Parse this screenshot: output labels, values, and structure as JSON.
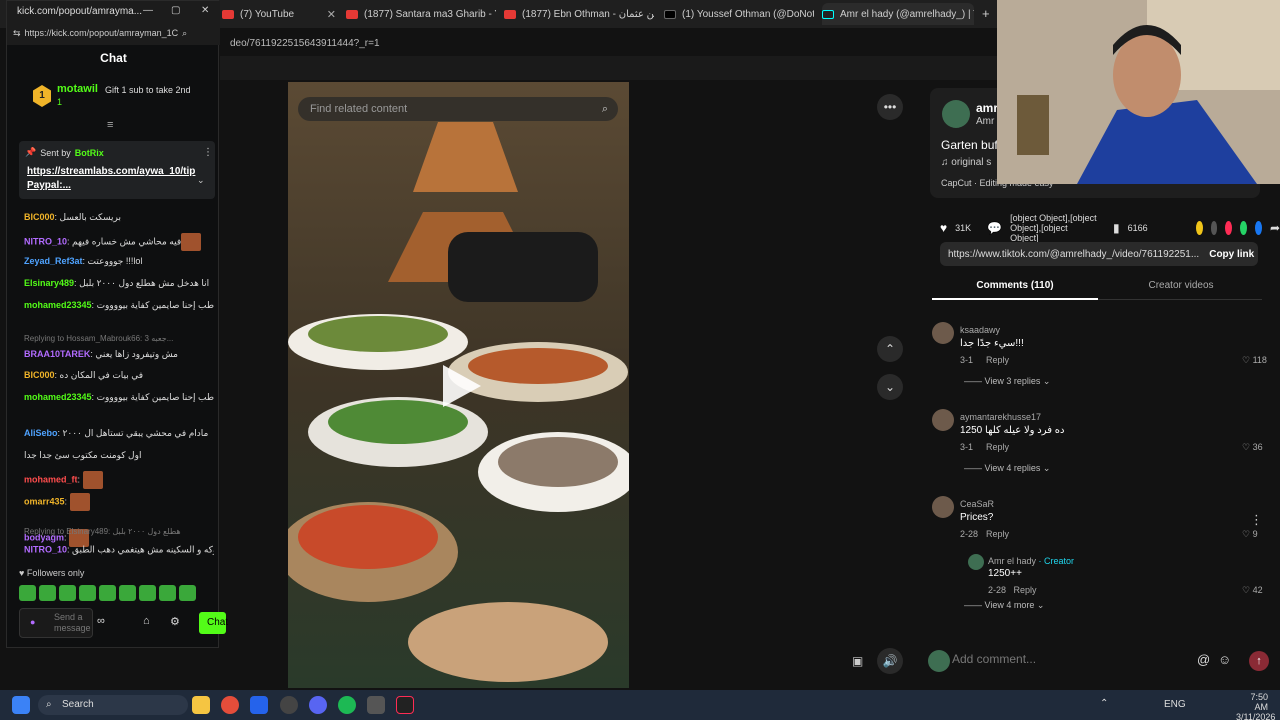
{
  "browser": {
    "tabs": [
      {
        "label": "(7) YouTube"
      },
      {
        "label": "(1877) Santara ma3 Gharib - Yo"
      },
      {
        "label": "(1877) Ebn Othman - ابن عثمان"
      },
      {
        "label": "(1) Youssef Othman (@DoNotG"
      },
      {
        "label": "Amr el hady (@amrelhady_) | T"
      }
    ],
    "url_fragment": "deo/7611922515643911444?_r=1"
  },
  "kick": {
    "window_title": "kick.com/popout/amrayma...",
    "address": "https://kick.com/popout/amrayman_1C",
    "chat_title": "Chat",
    "top_gifter": {
      "rank": "1",
      "name": "motawil",
      "count": "1"
    },
    "gift_prompt": "Gift 1 sub to take 2nd",
    "pinned": {
      "sent_by": "Sent by",
      "bot": "BotRix",
      "link": "https://streamlabs.com/aywa_10/tip",
      "extra": "Paypal:..."
    },
    "messages": [
      {
        "user": "BIC000",
        "text": "بريسكت بالعسل",
        "color": "#f0b429"
      },
      {
        "user": "NITRO_10",
        "text": "فيه محاشي مش خساره فيهم",
        "color": "#b26bff"
      },
      {
        "user": "Zeyad_Ref3at",
        "text": "جوووعتت !!!lol",
        "color": "#4fa3ff"
      },
      {
        "user": "Elsinary489",
        "text": "انا هدخل مش هطلع دول ٢٠٠٠ بلبل",
        "color": "#53fc18"
      },
      {
        "user": "mohamed23345",
        "text": "طب إحنا صايمين كفاية بيووووت",
        "color": "#53fc18"
      },
      {
        "user": "BRAA10TAREK",
        "text": "مش وتيفرود زاها يعني",
        "color": "#b26bff",
        "reply": "Replying to Hossam_Mabrouk66: جعبه 3..."
      },
      {
        "user": "BIC000",
        "text": "في بيات في المكان ده",
        "color": "#f0b429"
      },
      {
        "user": "mohamed23345",
        "text": "طب إحنا صايمين كفاية بيووووت",
        "color": "#53fc18"
      },
      {
        "user": "AliSebo",
        "text": "مادام في محشي يبقي تستاهل ال ٢٠٠٠",
        "color": "#4fa3ff"
      },
      {
        "user": "",
        "text": "اول كومنت مكتوب سئ جدا جدا",
        "color": "#ddd"
      },
      {
        "user": "mohamed_ft",
        "text": "",
        "color": "#ff4d4d"
      },
      {
        "user": "omarr435",
        "text": "",
        "color": "#f0b429"
      },
      {
        "user": "bodyagm",
        "text": "",
        "color": "#b26bff"
      },
      {
        "user": "NITRO_10",
        "text": "المكان في التجمع لازم الشوكه و السكينه مش هيتغمي دهب الطبق",
        "color": "#b26bff",
        "reply": "Replying to Elsinary489: هطلع دول ٢٠٠٠ بلبل"
      }
    ],
    "followers_only": "Followers only",
    "input_placeholder": "Send a message",
    "chat_button": "Chat"
  },
  "video": {
    "search_placeholder": "Find related content"
  },
  "tiktok": {
    "author": "amr",
    "author_sub": "Amr",
    "caption": "Garten buff",
    "sound": "original s",
    "capcut": "CapCut · Editing made easy",
    "likes": "31K",
    "comments": [
      {
        "user": "ksaadawy",
        "text": "سيء جدًا جدا!!!",
        "date": "3-1",
        "likes": "118",
        "more": "View 3 replies"
      },
      {
        "user": "aymantarekhusse17",
        "text": "1250 ده فرد ولا عيله كلها",
        "date": "3-1",
        "likes": "36",
        "more": "View 4 replies"
      },
      {
        "user": "CeaSaR",
        "text": "Prices?",
        "date": "2-28",
        "likes": "9",
        "more": "View 4 more"
      }
    ],
    "saves": "6166",
    "share_link": "https://www.tiktok.com/@amrelhady_/video/761192251...",
    "copy_link": "Copy link",
    "tab_comments": "Comments (110)",
    "tab_creator": "Creator videos",
    "creator_reply": {
      "user": "Amr el hady",
      "badge": "· Creator",
      "text": "1250++",
      "date": "2-28",
      "likes": "42"
    },
    "reply_label": "Reply",
    "add_comment": "Add comment..."
  },
  "taskbar": {
    "search": "Search",
    "lang": "ENG",
    "time": "7:50 AM",
    "date": "3/11/2026"
  }
}
